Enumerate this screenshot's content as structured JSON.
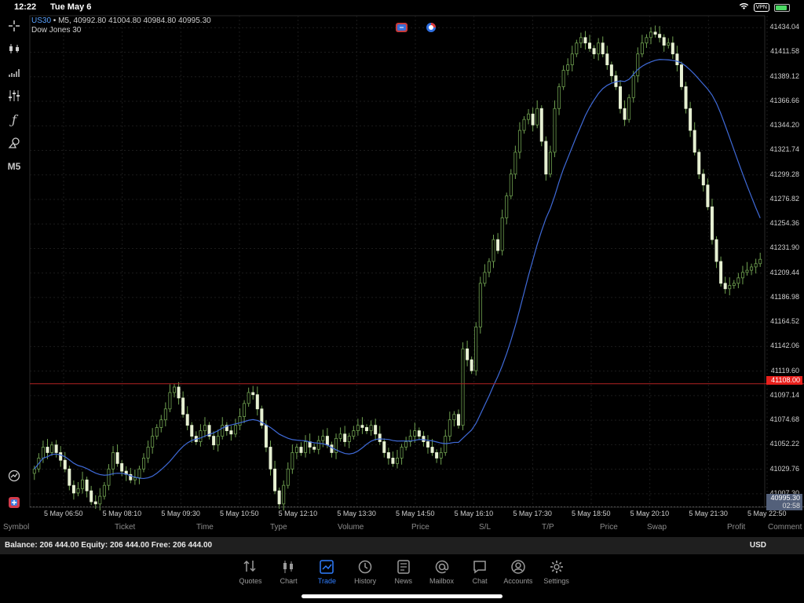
{
  "status": {
    "time": "12:22",
    "date": "Tue May 6",
    "vpn": "VPN"
  },
  "toolbar": {
    "timeframe": "M5"
  },
  "header": {
    "symbol": "US30",
    "ohlc": " • M5, 40992.80 41004.80 40984.80 40995.30",
    "name": "Dow Jones 30"
  },
  "colors": {
    "accent": "#2f7dff",
    "ma": "#3f6ad8",
    "candle": "#e6f0d2",
    "wick": "#6fa050",
    "redline": "#b22222",
    "badge_red": "#e8201c"
  },
  "price_axis": [
    "41434.04",
    "41411.58",
    "41389.12",
    "41366.66",
    "41344.20",
    "41321.74",
    "41299.28",
    "41276.82",
    "41254.36",
    "41231.90",
    "41209.44",
    "41186.98",
    "41164.52",
    "41142.06",
    "41119.60",
    "41097.14",
    "41074.68",
    "41052.22",
    "41029.76",
    "41007.30"
  ],
  "price_badges": {
    "red_line": "41108.00",
    "bid": "40995.30",
    "timer": "02:58"
  },
  "time_axis": [
    "5 May 06:50",
    "5 May 08:10",
    "5 May 09:30",
    "5 May 10:50",
    "5 May 12:10",
    "5 May 13:30",
    "5 May 14:50",
    "5 May 16:10",
    "5 May 17:30",
    "5 May 18:50",
    "5 May 20:10",
    "5 May 21:30",
    "5 May 22:50"
  ],
  "columns": [
    "Symbol",
    "Ticket",
    "Time",
    "Type",
    "Volume",
    "Price",
    "S/L",
    "T/P",
    "Price",
    "Swap",
    "Profit",
    "Comment"
  ],
  "balance": {
    "text": "Balance: 206 444.00 Equity: 206 444.00 Free: 206 444.00",
    "currency": "USD"
  },
  "tabs": [
    {
      "label": "Quotes",
      "icon": "quotes-icon"
    },
    {
      "label": "Chart",
      "icon": "chart-icon"
    },
    {
      "label": "Trade",
      "icon": "trade-icon",
      "active": true
    },
    {
      "label": "History",
      "icon": "history-icon"
    },
    {
      "label": "News",
      "icon": "news-icon"
    },
    {
      "label": "Mailbox",
      "icon": "mailbox-icon"
    },
    {
      "label": "Chat",
      "icon": "chat-icon"
    },
    {
      "label": "Accounts",
      "icon": "accounts-icon"
    },
    {
      "label": "Settings",
      "icon": "settings-icon"
    }
  ],
  "chart_data": {
    "type": "candlestick",
    "symbol": "US30",
    "timeframe": "M5",
    "ylim": [
      40995,
      41445
    ],
    "red_line": 41108.0,
    "bid_line": 40995.3,
    "closes": [
      41030,
      41040,
      41050,
      41045,
      41052,
      41045,
      41038,
      41030,
      41015,
      41008,
      41012,
      41020,
      41010,
      41000,
      40998,
      41005,
      41015,
      41030,
      41045,
      41035,
      41028,
      41025,
      41020,
      41022,
      41030,
      41040,
      41050,
      41060,
      41068,
      41075,
      41085,
      41100,
      41105,
      41095,
      41080,
      41070,
      41060,
      41055,
      41065,
      41070,
      41060,
      41052,
      41060,
      41070,
      41065,
      41062,
      41070,
      41078,
      41090,
      41100,
      41098,
      41085,
      41070,
      41050,
      41030,
      41010,
      40998,
      41015,
      41030,
      41045,
      41050,
      41045,
      41055,
      41050,
      41048,
      41056,
      41060,
      41052,
      41045,
      41058,
      41062,
      41055,
      41060,
      41065,
      41070,
      41068,
      41065,
      41070,
      41062,
      41055,
      41045,
      41040,
      41035,
      41040,
      41050,
      41055,
      41060,
      41065,
      41060,
      41055,
      41050,
      41045,
      41040,
      41045,
      41060,
      41075,
      41080,
      41070,
      41140,
      41130,
      41120,
      41160,
      41200,
      41210,
      41220,
      41240,
      41230,
      41260,
      41280,
      41300,
      41320,
      41340,
      41350,
      41355,
      41345,
      41360,
      41330,
      41300,
      41320,
      41360,
      41380,
      41395,
      41400,
      41410,
      41420,
      41425,
      41420,
      41415,
      41410,
      41420,
      41410,
      41400,
      41390,
      41380,
      41360,
      41350,
      41370,
      41390,
      41410,
      41420,
      41425,
      41430,
      41428,
      41425,
      41418,
      41420,
      41410,
      41400,
      41380,
      41360,
      41340,
      41320,
      41300,
      41290,
      41270,
      41240,
      41220,
      41200,
      41195,
      41198,
      41200,
      41205,
      41210,
      41212,
      41215,
      41218,
      41222
    ]
  }
}
